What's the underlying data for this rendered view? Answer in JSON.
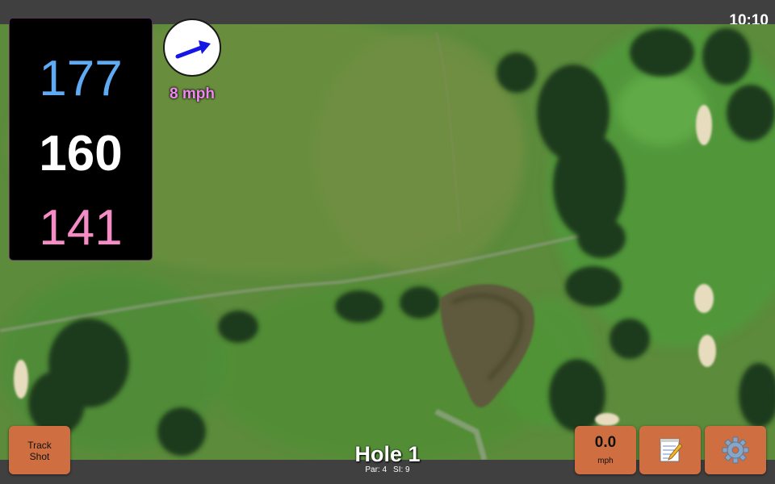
{
  "status": {
    "time": "10:10"
  },
  "distances": {
    "back": "177",
    "middle": "160",
    "front": "141"
  },
  "wind": {
    "speed": "8 mph",
    "icon": "wind-arrow-icon",
    "arrow_color": "#1515e6"
  },
  "hole": {
    "title": "Hole 1",
    "par": "Par: 4",
    "stroke_index": "SI: 9"
  },
  "buttons": {
    "track_shot": "Track\nShot",
    "speed_value": "0.0",
    "speed_unit": "mph",
    "notes_icon": "notepad-icon",
    "settings_icon": "gear-icon"
  },
  "colors": {
    "back_distance": "#60aaf4",
    "middle_distance": "#ffffff",
    "front_distance": "#f58cc6",
    "button": "#cf6e40",
    "wind_speed": "#ee88ee"
  }
}
